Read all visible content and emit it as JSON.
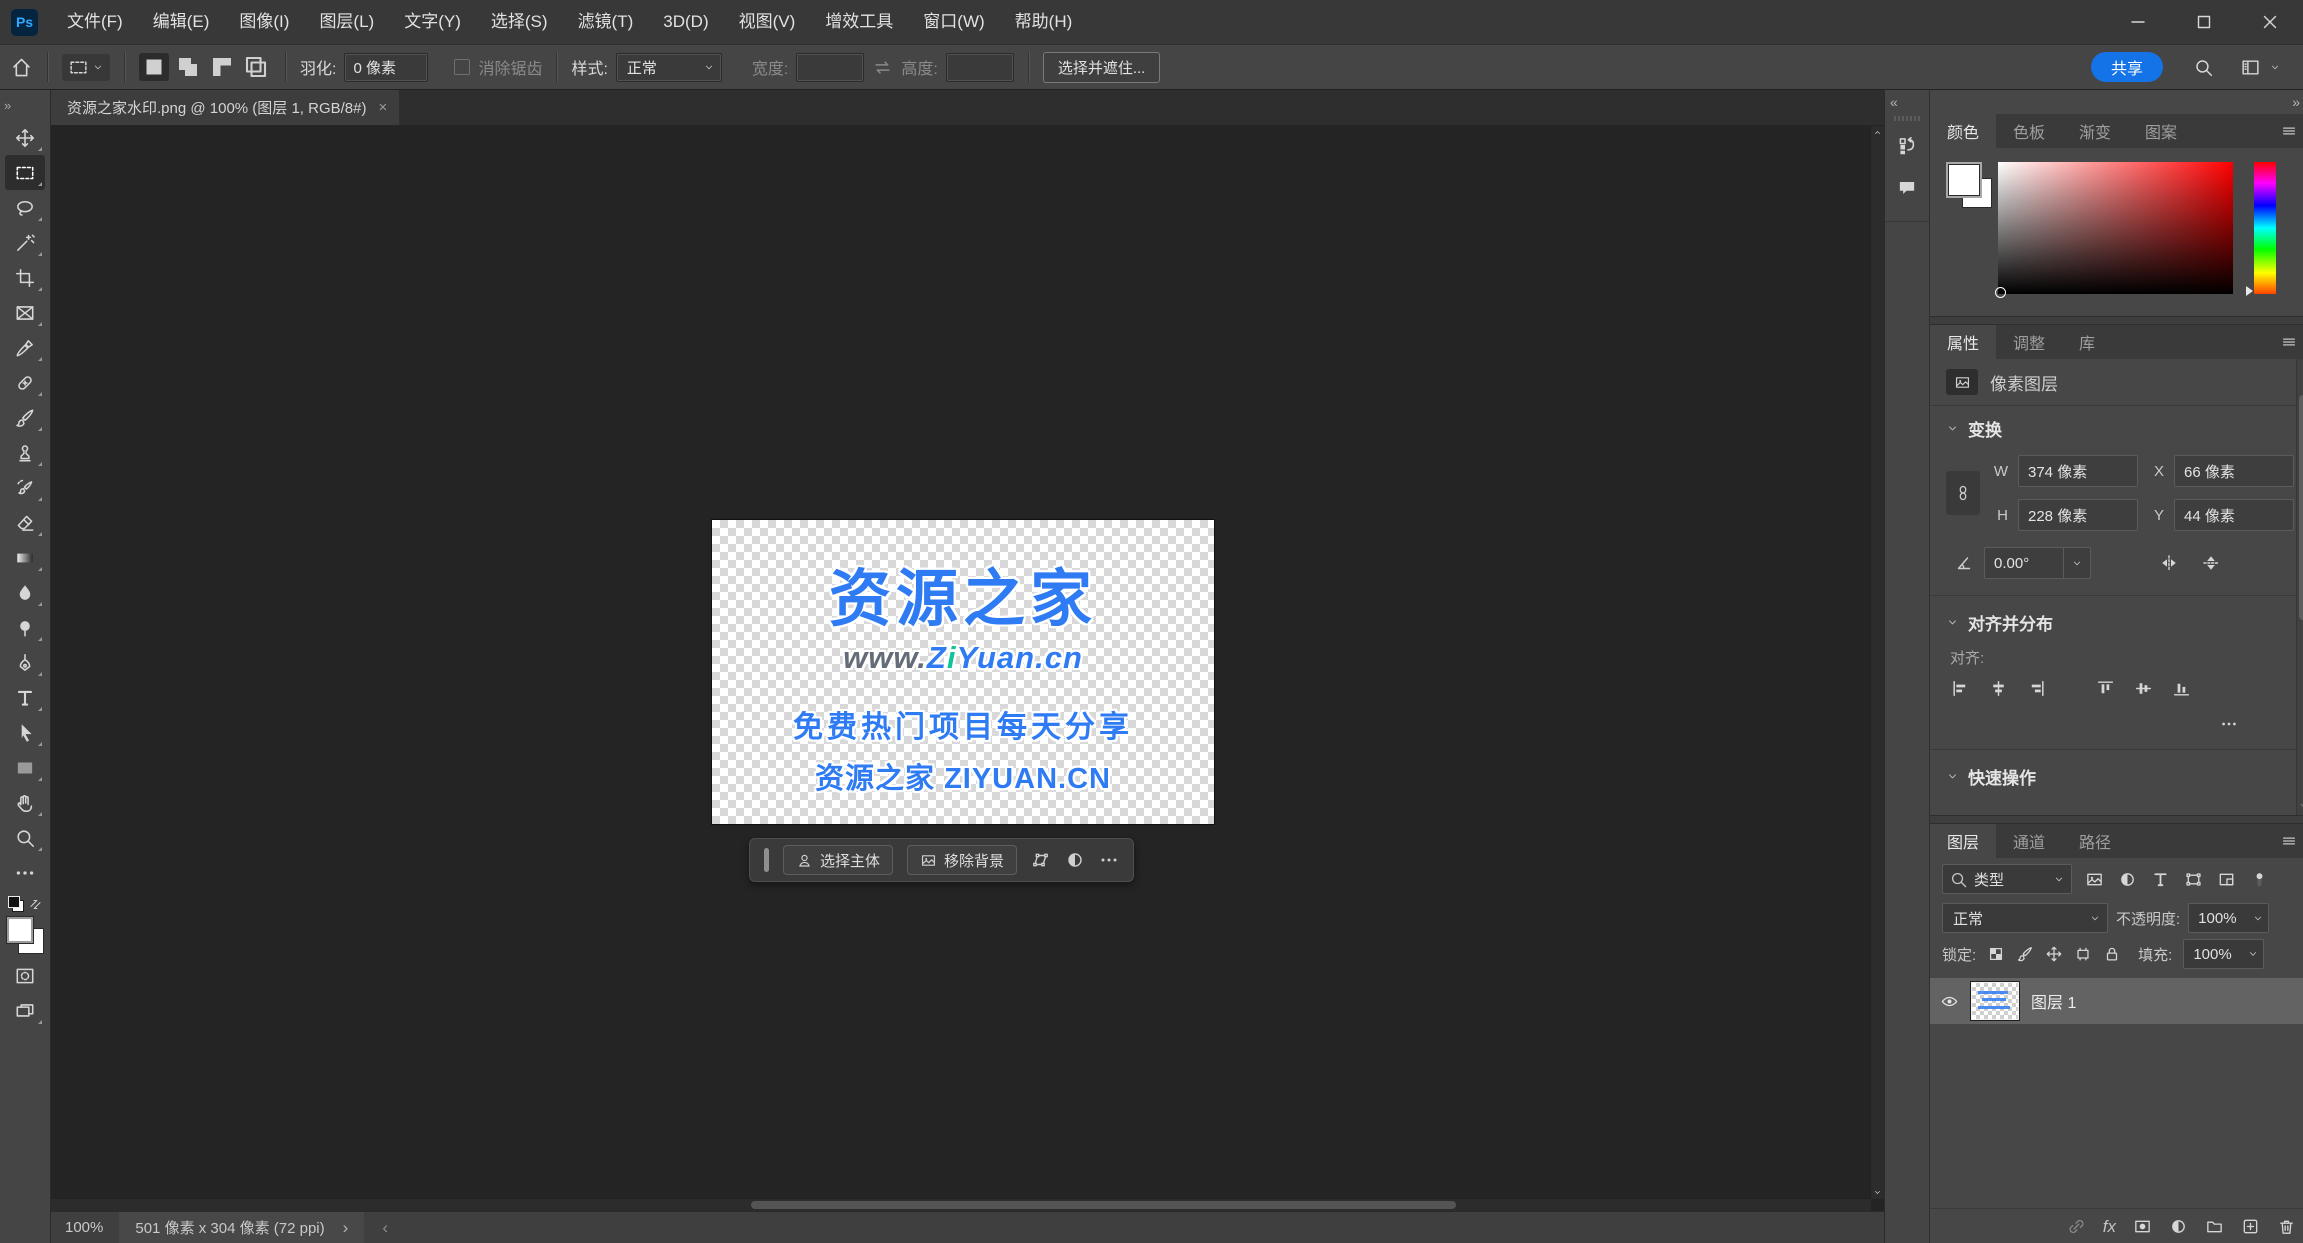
{
  "titlebar": {
    "logo": "Ps",
    "menus": [
      "文件(F)",
      "编辑(E)",
      "图像(I)",
      "图层(L)",
      "文字(Y)",
      "选择(S)",
      "滤镜(T)",
      "3D(D)",
      "视图(V)",
      "增效工具",
      "窗口(W)",
      "帮助(H)"
    ],
    "window_controls": [
      {
        "name": "minimize-button",
        "icon": "minus"
      },
      {
        "name": "maximize-button",
        "icon": "maxi"
      },
      {
        "name": "close-button",
        "icon": "close"
      }
    ]
  },
  "options_bar": {
    "tool_modes": [
      {
        "name": "new-selection-mode",
        "icon": "modenew",
        "selected": true
      },
      {
        "name": "add-selection-mode",
        "icon": "modeadd",
        "selected": false
      },
      {
        "name": "subtract-selection-mode",
        "icon": "modesub",
        "selected": false
      },
      {
        "name": "intersect-selection-mode",
        "icon": "modeint",
        "selected": false
      }
    ],
    "feather_label": "羽化:",
    "feather_value": "0 像素",
    "antialias_label": "消除锯齿",
    "style_label": "样式:",
    "style_value": "正常",
    "width_label": "宽度:",
    "width_value": "",
    "height_label": "高度:",
    "height_value": "",
    "select_mask_button": "选择并遮住...",
    "share_button": "共享"
  },
  "document": {
    "tab_title": "资源之家水印.png @ 100% (图层 1, RGB/8#)",
    "close_glyph": "×",
    "collapse_left": "»"
  },
  "toolbar": {
    "tools": [
      {
        "name": "move-tool",
        "icon": "move",
        "selected": false
      },
      {
        "name": "rectangular-marquee-tool",
        "icon": "marquee",
        "selected": true
      },
      {
        "name": "lasso-tool",
        "icon": "lasso",
        "selected": false
      },
      {
        "name": "magic-wand-tool",
        "icon": "wand",
        "selected": false
      },
      {
        "name": "crop-tool",
        "icon": "crop",
        "selected": false
      },
      {
        "name": "frame-tool",
        "icon": "frame",
        "selected": false
      },
      {
        "name": "eyedropper-tool",
        "icon": "eyedropper",
        "selected": false
      },
      {
        "name": "spot-healing-brush-tool",
        "icon": "healing",
        "selected": false
      },
      {
        "name": "brush-tool",
        "icon": "brush",
        "selected": false
      },
      {
        "name": "clone-stamp-tool",
        "icon": "stamp",
        "selected": false
      },
      {
        "name": "history-brush-tool",
        "icon": "historybrush",
        "selected": false
      },
      {
        "name": "eraser-tool",
        "icon": "eraser",
        "selected": false
      },
      {
        "name": "gradient-tool",
        "icon": "gradient",
        "selected": false
      },
      {
        "name": "blur-tool",
        "icon": "blur",
        "selected": false
      },
      {
        "name": "dodge-tool",
        "icon": "dodge",
        "selected": false
      },
      {
        "name": "pen-tool",
        "icon": "pen",
        "selected": false
      },
      {
        "name": "type-tool",
        "icon": "type",
        "selected": false
      },
      {
        "name": "path-selection-tool",
        "icon": "patharrow",
        "selected": false
      },
      {
        "name": "rectangle-tool",
        "icon": "rectangle",
        "selected": false
      },
      {
        "name": "hand-tool",
        "icon": "hand",
        "selected": false
      },
      {
        "name": "zoom-tool",
        "icon": "zoomtool",
        "selected": false
      },
      {
        "name": "edit-toolbar",
        "icon": "ellipsis",
        "selected": false
      }
    ]
  },
  "canvas": {
    "watermark": {
      "title": "资源之家",
      "url_prefix": "www.",
      "url_z": "Z",
      "url_i": "i",
      "url_rest": "Yuan.cn",
      "line3": "免费热门项目每天分享",
      "line4": "资源之家 ZIYUAN.CN"
    }
  },
  "context_bar": {
    "select_subject": "选择主体",
    "remove_background": "移除背景"
  },
  "dock": {
    "collapse_glyph": "«",
    "expand_glyph": "»",
    "strip_icons": [
      {
        "name": "version-history-panel-icon",
        "icon": "historypanel"
      },
      {
        "name": "comments-panel-icon",
        "icon": "comment"
      }
    ],
    "color_panel": {
      "tabs": [
        "颜色",
        "色板",
        "渐变",
        "图案"
      ],
      "active_tab": "颜色"
    },
    "properties_panel": {
      "tabs": [
        "属性",
        "调整",
        "库"
      ],
      "active_tab": "属性",
      "layer_type": "像素图层",
      "transform": {
        "title": "变换",
        "w_label": "W",
        "w_value": "374 像素",
        "x_label": "X",
        "x_value": "66 像素",
        "h_label": "H",
        "h_value": "228 像素",
        "y_label": "Y",
        "y_value": "44 像素",
        "angle_value": "0.00°"
      },
      "align": {
        "title": "对齐并分布",
        "align_label": "对齐:",
        "icons": [
          {
            "name": "align-left-icon",
            "icon": "alignleft"
          },
          {
            "name": "align-horizontal-center-icon",
            "icon": "alignhc"
          },
          {
            "name": "align-right-icon",
            "icon": "alignright"
          },
          {
            "name": "align-top-icon",
            "icon": "aligntop"
          },
          {
            "name": "align-vertical-center-icon",
            "icon": "alignvc"
          },
          {
            "name": "align-bottom-icon",
            "icon": "alignbottom"
          }
        ]
      },
      "quick_actions_title": "快速操作"
    },
    "layers_panel": {
      "tabs": [
        "图层",
        "通道",
        "路径"
      ],
      "active_tab": "图层",
      "filter_label": "类型",
      "filter_icons": [
        {
          "name": "filter-pixel-layers-icon",
          "icon": "imageicon"
        },
        {
          "name": "filter-adjustment-layers-icon",
          "icon": "halfcircle"
        },
        {
          "name": "filter-type-layers-icon",
          "icon": "type"
        },
        {
          "name": "filter-shape-layers-icon",
          "icon": "shapenodes"
        },
        {
          "name": "filter-smart-objects-icon",
          "icon": "smartobj"
        },
        {
          "name": "filter-toggle",
          "icon": "toggle"
        }
      ],
      "blend_mode": "正常",
      "opacity_label": "不透明度:",
      "opacity_value": "100%",
      "lock_label": "锁定:",
      "lock_icons": [
        {
          "name": "lock-transparency-icon",
          "icon": "lockchecker"
        },
        {
          "name": "lock-pixels-icon",
          "icon": "brush"
        },
        {
          "name": "lock-position-icon",
          "icon": "move"
        },
        {
          "name": "lock-artboard-icon",
          "icon": "artboardlock"
        },
        {
          "name": "lock-all-icon",
          "icon": "locklock"
        }
      ],
      "fill_label": "填充:",
      "fill_value": "100%",
      "layer_name": "图层 1",
      "bottom_icons": [
        {
          "name": "link-layers-button",
          "icon": "linkchain",
          "dim": true
        },
        {
          "name": "layer-effects-button",
          "icon": "fx"
        },
        {
          "name": "add-layer-mask-button",
          "icon": "maskicon"
        },
        {
          "name": "new-adjustment-layer-button",
          "icon": "halfcircle"
        },
        {
          "name": "new-group-button",
          "icon": "folder"
        },
        {
          "name": "new-layer-button",
          "icon": "plussquare"
        },
        {
          "name": "delete-layer-button",
          "icon": "trash"
        }
      ]
    }
  },
  "statusbar": {
    "zoom": "100%",
    "doc_info": "501 像素 x 304 像素 (72 ppi)",
    "expand_glyph": "›",
    "scroll_left_glyph": "‹"
  }
}
